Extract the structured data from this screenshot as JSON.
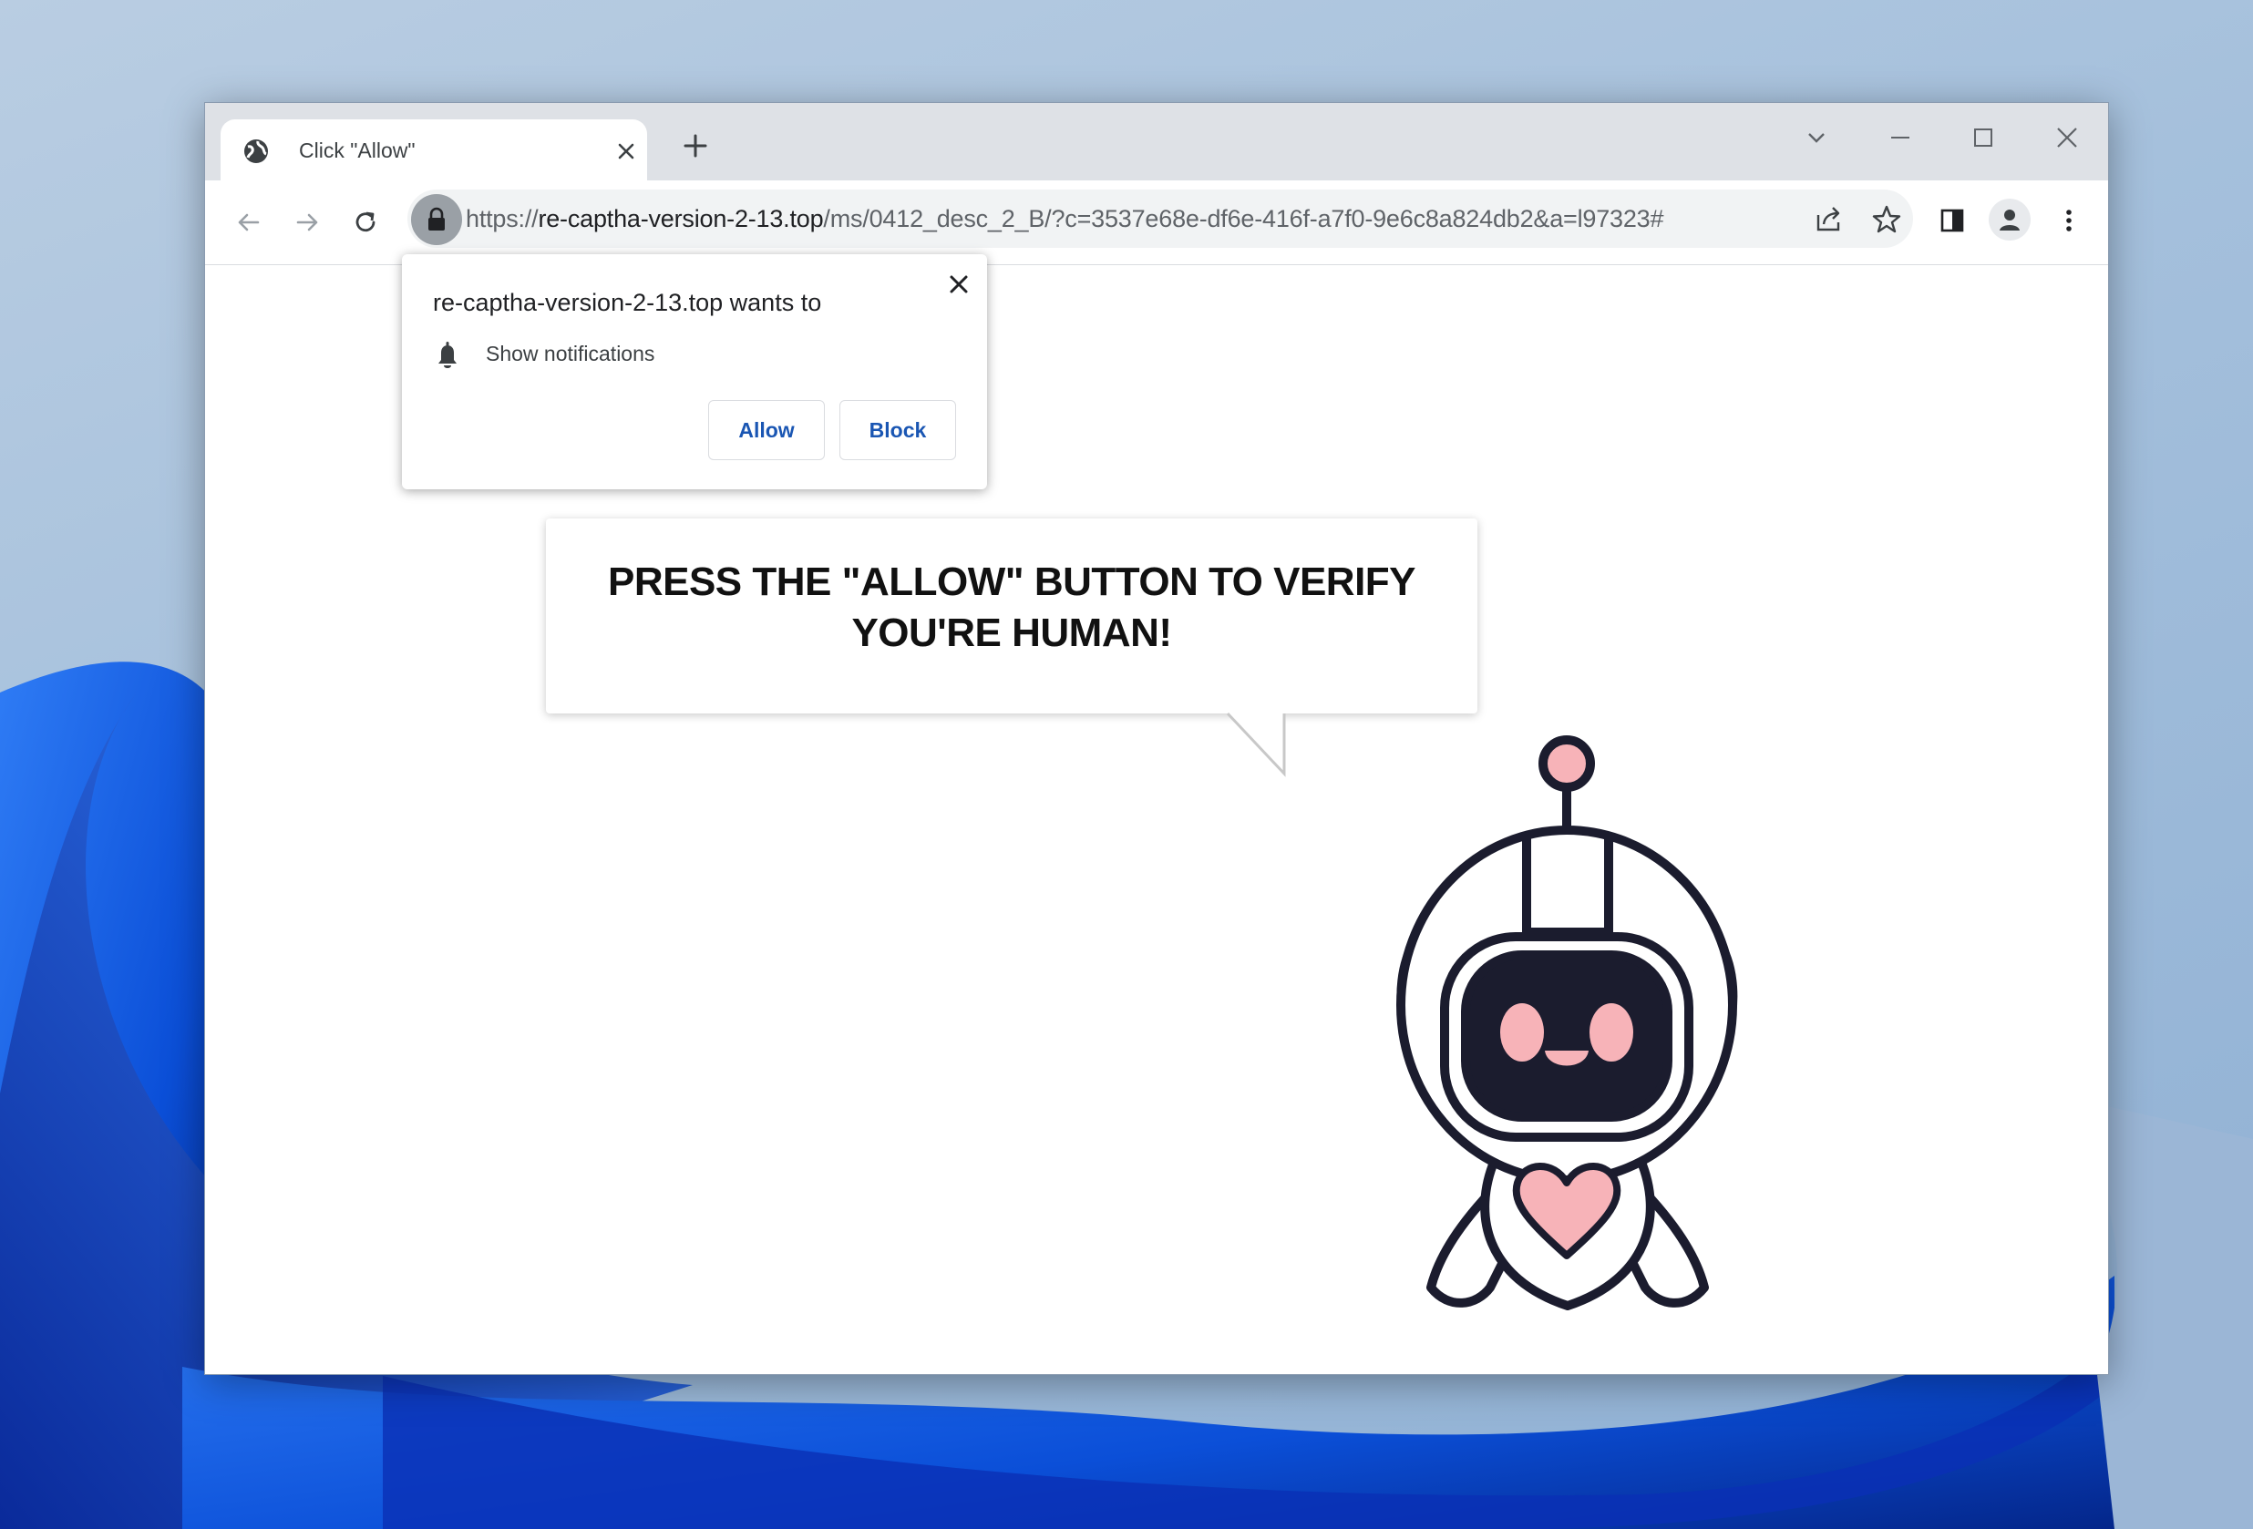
{
  "tab": {
    "title": "Click \"Allow\"",
    "icon": "globe-icon"
  },
  "address_bar": {
    "scheme": "https://",
    "host": "re-captha-version-2-13.top",
    "rest": "/ms/0412_desc_2_B/?c=3537e68e-df6e-416f-a7f0-9e6c8a824db2&a=l97323#"
  },
  "permission_popup": {
    "title": "re-captha-version-2-13.top wants to",
    "permission": "Show notifications",
    "allow_label": "Allow",
    "block_label": "Block"
  },
  "page": {
    "headline_line1": "PRESS THE \"ALLOW\" BUTTON TO VERIFY",
    "headline_line2": "YOU'RE HUMAN!"
  },
  "colors": {
    "accent": "#1a56b3",
    "robot_pink": "#f7b3b8",
    "robot_outline": "#1b1c2e"
  }
}
